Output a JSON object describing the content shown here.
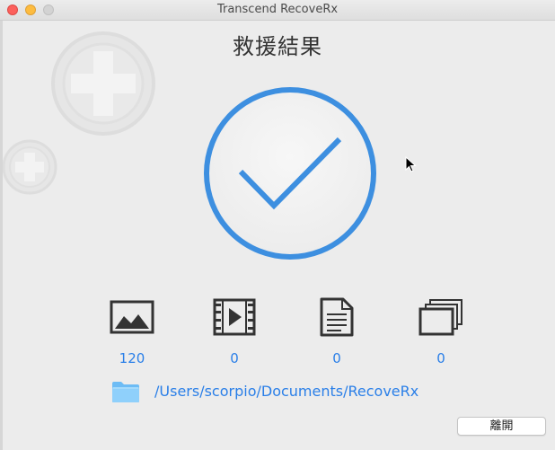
{
  "window": {
    "title": "Transcend RecoveRx"
  },
  "heading": "救援結果",
  "stats": [
    {
      "kind": "photos",
      "icon": "image-icon",
      "count": "120"
    },
    {
      "kind": "videos",
      "icon": "video-icon",
      "count": "0"
    },
    {
      "kind": "documents",
      "icon": "document-icon",
      "count": "0"
    },
    {
      "kind": "others",
      "icon": "stacked-files-icon",
      "count": "0"
    }
  ],
  "output": {
    "icon": "folder-icon",
    "path": "/Users/scorpio/Documents/RecoveRx"
  },
  "actions": {
    "close_label": "離開"
  },
  "colors": {
    "accent": "#3d8fe0",
    "link": "#2a7fe8",
    "icon_dark": "#333333"
  }
}
